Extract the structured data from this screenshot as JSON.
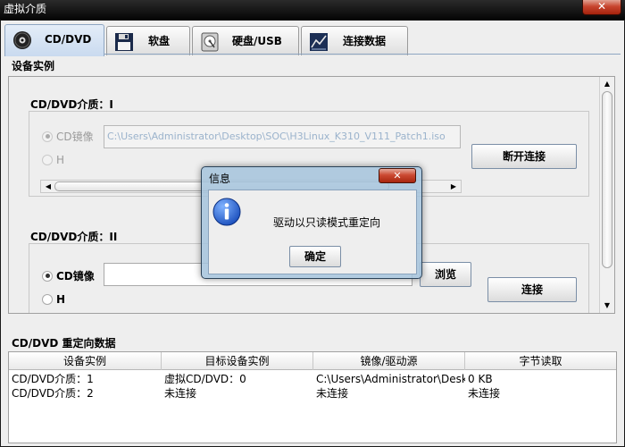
{
  "window": {
    "title": "虚拟介质",
    "close_glyph": "✕"
  },
  "tabs": [
    {
      "label": "CD/DVD",
      "icon": "disc-icon",
      "active": true
    },
    {
      "label": "软盘",
      "icon": "floppy-icon",
      "active": false
    },
    {
      "label": "硬盘/USB",
      "icon": "hard-disk-icon",
      "active": false
    },
    {
      "label": "连接数据",
      "icon": "line-chart-icon",
      "active": false
    }
  ],
  "devices_panel": {
    "title": "设备实例",
    "media_1": {
      "title": "CD/DVD介质：I",
      "option_image": "CD镜像",
      "option_host": "H",
      "selected": "image",
      "path_value": "C:\\Users\\Administrator\\Desktop\\SOC\\H3Linux_K310_V111_Patch1.iso",
      "disconnect_button": "断开连接"
    },
    "media_2": {
      "title": "CD/DVD介质：II",
      "option_image": "CD镜像",
      "option_host": "H",
      "selected": "image",
      "path_value": "",
      "browse_button": "浏览",
      "connect_button": "连接"
    }
  },
  "redirect_section": {
    "title": "CD/DVD 重定向数据",
    "columns": [
      "设备实例",
      "目标设备实例",
      "镜像/驱动源",
      "字节读取"
    ],
    "rows": [
      [
        "CD/DVD介质：1",
        "虚拟CD/DVD：0",
        "C:\\Users\\Administrator\\Desk...",
        "0 KB"
      ],
      [
        "CD/DVD介质：2",
        "未连接",
        "未连接",
        "未连接"
      ]
    ]
  },
  "dialog": {
    "title": "信息",
    "message": "驱动以只读模式重定向",
    "ok_button": "确定",
    "close_glyph": "✕"
  },
  "colors": {
    "active_tab": "#c9daef",
    "dialog_frame": "#a5c3dc",
    "close_button": "#cc4a33",
    "disabled_path_text": "#9bb3cc"
  }
}
